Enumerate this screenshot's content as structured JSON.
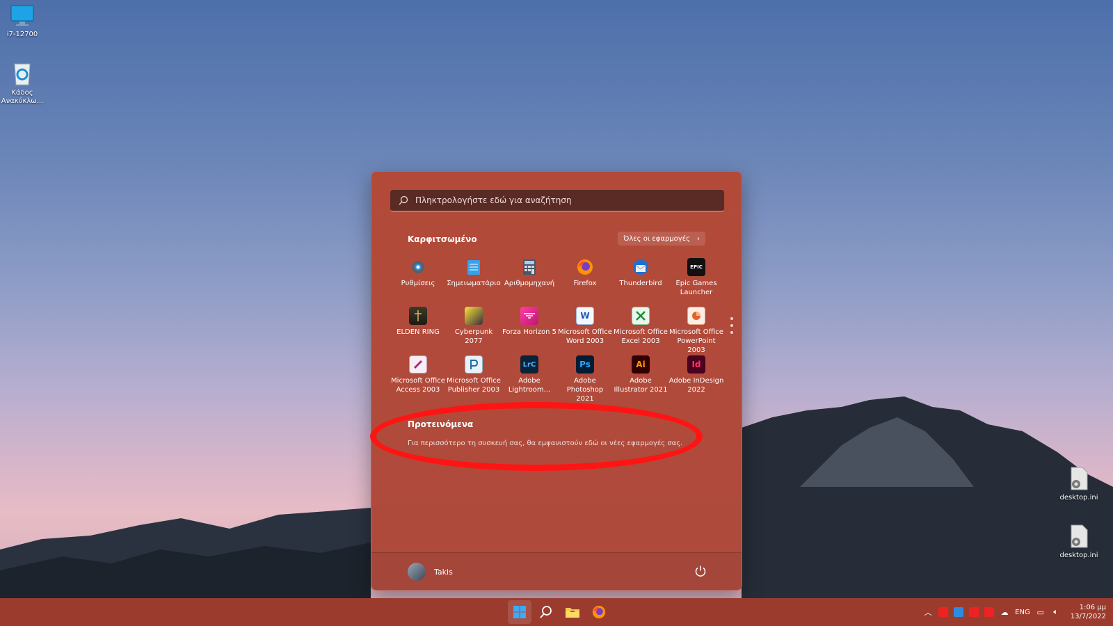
{
  "desktop": {
    "icons": [
      {
        "label": "i7-12700",
        "icon": "monitor-icon"
      },
      {
        "label": "Κάδος Ανακύκλω...",
        "icon": "recycle-bin-icon"
      },
      {
        "label": "desktop.ini",
        "icon": "settings-file-icon"
      },
      {
        "label": "desktop.ini",
        "icon": "settings-file-icon"
      }
    ]
  },
  "start_menu": {
    "search_placeholder": "Πληκτρολογήστε εδώ για αναζήτηση",
    "pinned_title": "Καρφιτσωμένο",
    "all_apps_label": "Όλες οι εφαρμογές",
    "pinned_apps": [
      {
        "label": "Ρυθμίσεις",
        "icon": "settings-gear-icon"
      },
      {
        "label": "Σημειωματάριο",
        "icon": "notepad-icon"
      },
      {
        "label": "Αριθμομηχανή",
        "icon": "calculator-icon"
      },
      {
        "label": "Firefox",
        "icon": "firefox-icon"
      },
      {
        "label": "Thunderbird",
        "icon": "thunderbird-icon"
      },
      {
        "label": "Epic Games Launcher",
        "icon": "epic-games-icon"
      },
      {
        "label": "ELDEN RING",
        "icon": "elden-ring-icon"
      },
      {
        "label": "Cyberpunk 2077",
        "icon": "cyberpunk-icon"
      },
      {
        "label": "Forza Horizon 5",
        "icon": "forza-icon"
      },
      {
        "label": "Microsoft Office Word 2003",
        "icon": "word-icon"
      },
      {
        "label": "Microsoft Office Excel 2003",
        "icon": "excel-icon"
      },
      {
        "label": "Microsoft Office PowerPoint 2003",
        "icon": "powerpoint-icon"
      },
      {
        "label": "Microsoft Office Access 2003",
        "icon": "access-icon"
      },
      {
        "label": "Microsoft Office Publisher 2003",
        "icon": "publisher-icon"
      },
      {
        "label": "Adobe Lightroom...",
        "icon": "lightroom-icon"
      },
      {
        "label": "Adobe Photoshop 2021",
        "icon": "photoshop-icon"
      },
      {
        "label": "Adobe Illustrator 2021",
        "icon": "illustrator-icon"
      },
      {
        "label": "Adobe InDesign 2022",
        "icon": "indesign-icon"
      }
    ],
    "icon_glyphs": {
      "lrc": "LrC",
      "ps": "Ps",
      "ai": "Ai",
      "id": "Id",
      "word": "W",
      "epic": "EPIC"
    },
    "recommended_title": "Προτεινόμενα",
    "recommended_text": "Για περισσότερο τη συσκευή σας, θα εμφανιστούν εδώ οι νέες εφαρμογές σας.",
    "user_name": "Takis"
  },
  "taskbar": {
    "tray": {
      "language": "ENG",
      "time": "1:06 μμ",
      "date": "13/7/2022"
    }
  },
  "colors": {
    "accent": "#b34a39",
    "taskbar": "#9b3b2e",
    "highlight_ring": "#ff1414"
  }
}
